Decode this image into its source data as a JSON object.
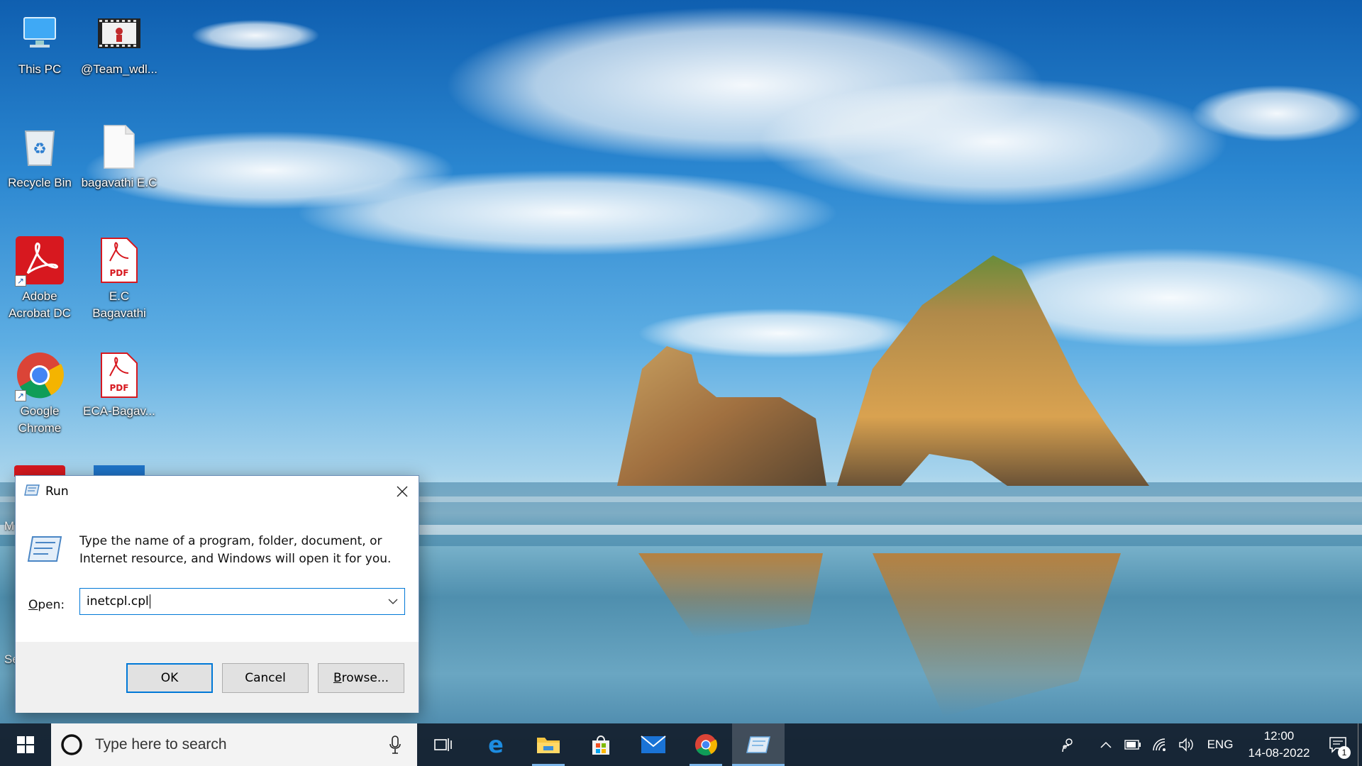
{
  "desktop": {
    "icons": [
      {
        "label": "This PC",
        "icon": "this-pc-icon"
      },
      {
        "label": "@Team_wdl...",
        "icon": "video-file-icon"
      },
      {
        "label": "Recycle Bin",
        "icon": "recycle-bin-icon"
      },
      {
        "label": "bagavathi E.C",
        "icon": "blank-file-icon"
      },
      {
        "label": "Adobe Acrobat DC",
        "icon": "adobe-acrobat-icon"
      },
      {
        "label": "E.C Bagavathi",
        "icon": "pdf-file-icon"
      },
      {
        "label": "Google Chrome",
        "icon": "chrome-icon"
      },
      {
        "label": "ECA-Bagav...",
        "icon": "pdf-file-icon"
      }
    ],
    "partial_labels": {
      "left_m": "M",
      "left_se": "Se"
    },
    "pdf_badge": "PDF"
  },
  "run_dialog": {
    "title": "Run",
    "description": "Type the name of a program, folder, document, or Internet resource, and Windows will open it for you.",
    "open_label_underline": "O",
    "open_label_rest": "pen:",
    "open_value": "inetcpl.cpl",
    "ok_label": "OK",
    "cancel_label": "Cancel",
    "browse_label_underline": "B",
    "browse_label_rest": "rowse..."
  },
  "taskbar": {
    "search_placeholder": "Type here to search",
    "apps": [
      "task-view-icon",
      "edge-icon",
      "file-explorer-icon",
      "store-icon",
      "mail-icon",
      "chrome-icon",
      "run-icon"
    ],
    "language": "ENG",
    "time": "12:00",
    "date": "14-08-2022",
    "notification_count": "1"
  },
  "colors": {
    "accent": "#0078d7",
    "taskbar": "#1e2a38"
  }
}
